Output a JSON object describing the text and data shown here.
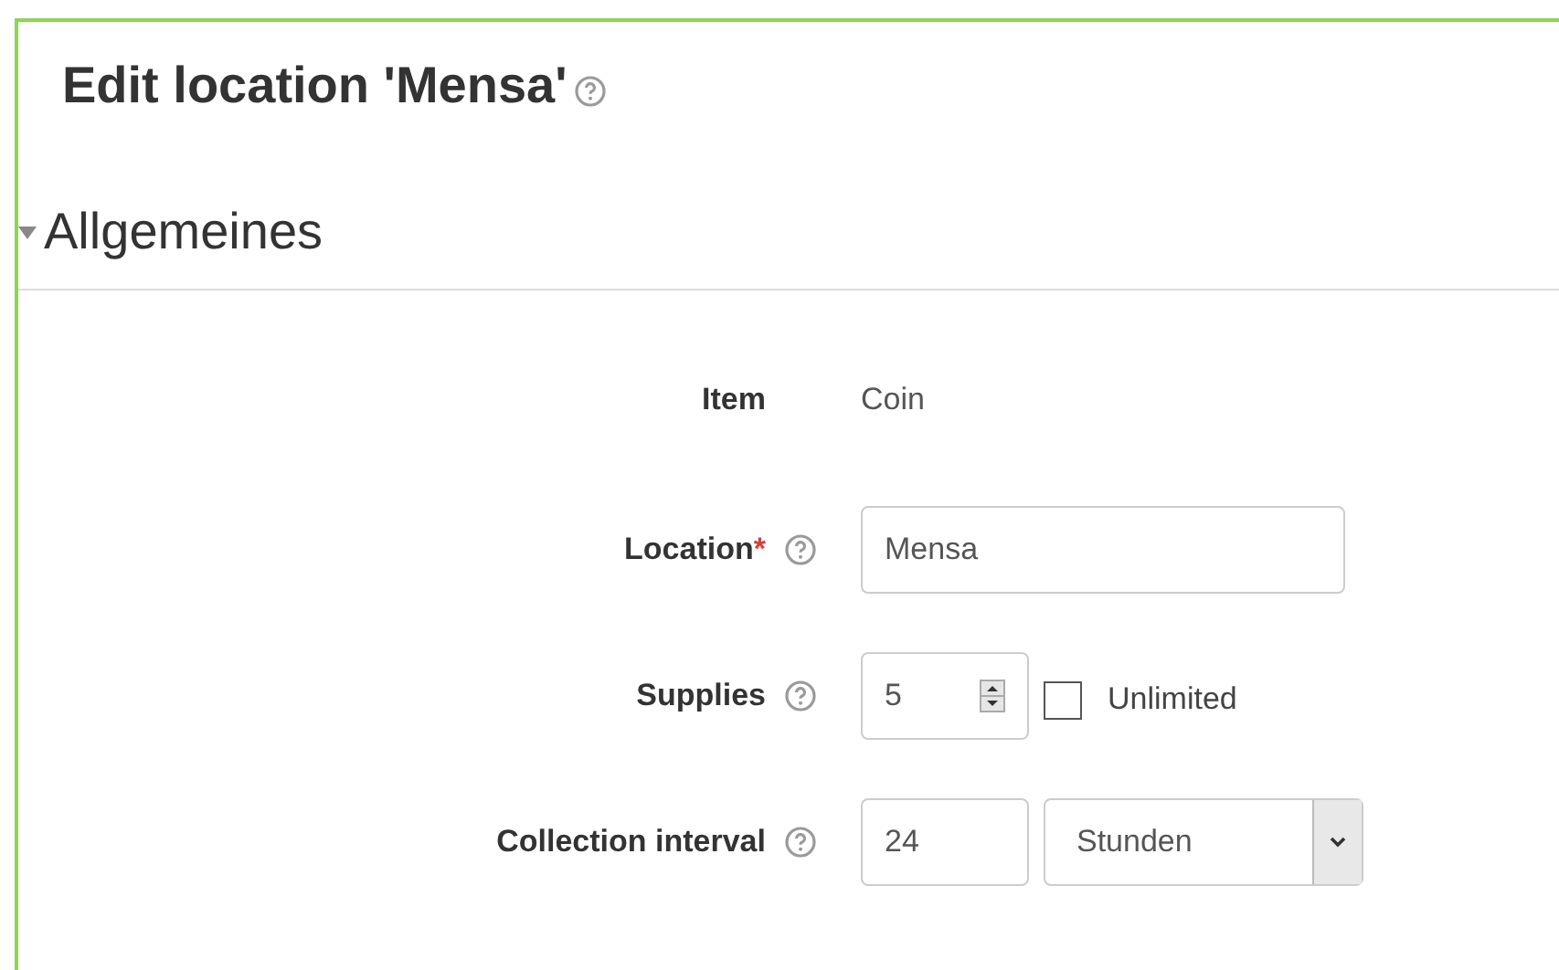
{
  "page": {
    "title": "Edit location 'Mensa'",
    "help": true
  },
  "section": {
    "title": "Allgemeines",
    "expanded": true
  },
  "fields": [
    {
      "kind": "static",
      "label": "Item",
      "required": false,
      "help": false,
      "value": "Coin"
    },
    {
      "kind": "text",
      "label": "Location",
      "required": true,
      "required_mark": "*",
      "help": true,
      "value": "Mensa"
    },
    {
      "kind": "number",
      "label": "Supplies",
      "required": false,
      "help": true,
      "value": "5",
      "checkbox": {
        "label": "Unlimited",
        "checked": false
      }
    },
    {
      "kind": "interval",
      "label": "Collection interval",
      "required": false,
      "help": true,
      "value": "24",
      "unit": "Stunden"
    }
  ]
}
